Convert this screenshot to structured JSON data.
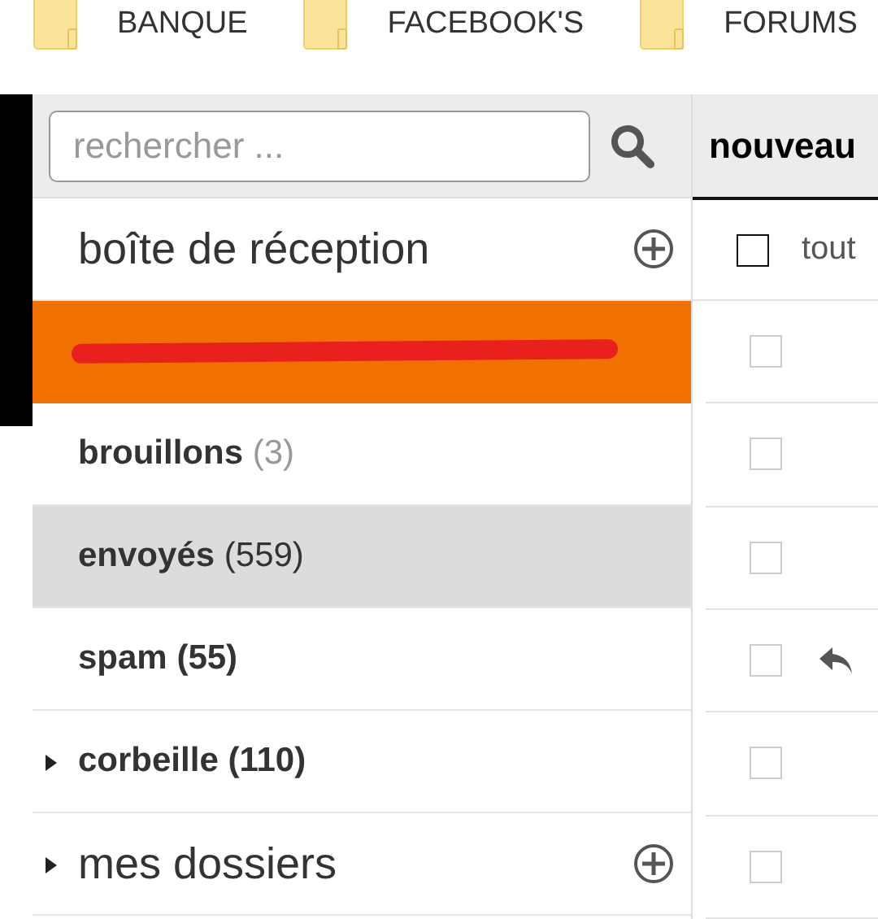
{
  "bookmarks": [
    {
      "label": "BANQUE"
    },
    {
      "label": "FACEBOOK'S"
    },
    {
      "label": "FORUMS"
    }
  ],
  "search": {
    "placeholder": "rechercher ..."
  },
  "sidebar": {
    "items": [
      {
        "kind": "section",
        "label": "boîte de réception"
      },
      {
        "kind": "redacted",
        "selected": true,
        "hovered": false
      },
      {
        "kind": "folder",
        "label": "brouillons",
        "count": "(3)",
        "count_bold": false,
        "count_muted": true,
        "selected": false,
        "hovered": false
      },
      {
        "kind": "folder",
        "label": "envoyés",
        "count": "(559)",
        "count_bold": false,
        "count_muted": false,
        "selected": false,
        "hovered": true
      },
      {
        "kind": "folder",
        "label": "spam",
        "count": "(55)",
        "count_bold": true,
        "count_muted": false,
        "selected": false,
        "hovered": false
      },
      {
        "kind": "folder",
        "label": "corbeille",
        "count": "(110)",
        "count_bold": true,
        "count_muted": false,
        "selected": false,
        "hovered": false,
        "expanded": false
      },
      {
        "kind": "section",
        "label": "mes dossiers",
        "expanded": false
      }
    ]
  },
  "message_list": {
    "header": "nouveau",
    "select_all": {
      "label": "tout",
      "checked": false
    },
    "rows": [
      {
        "checked": false,
        "replied": false
      },
      {
        "checked": false,
        "replied": false
      },
      {
        "checked": false,
        "replied": false
      },
      {
        "checked": false,
        "replied": true
      },
      {
        "checked": false,
        "replied": false
      },
      {
        "checked": false,
        "replied": false
      }
    ]
  }
}
